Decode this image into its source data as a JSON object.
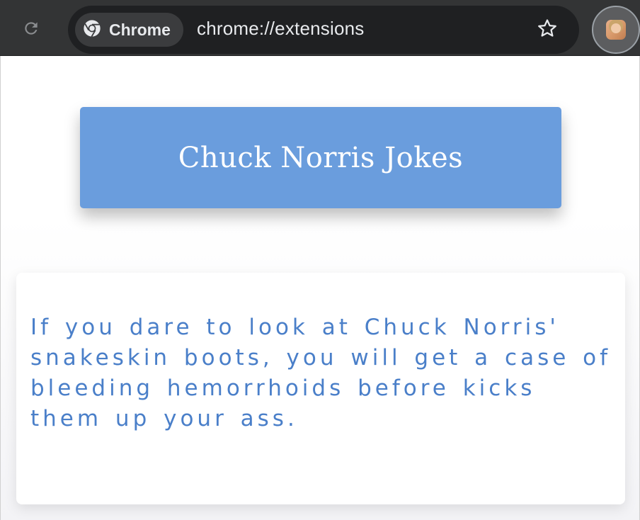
{
  "browser": {
    "chip_label": "Chrome",
    "url": "chrome://extensions",
    "icons": {
      "reload": "reload-icon",
      "chrome": "chrome-logo-icon",
      "bookmark": "star-icon",
      "extension": "extension-avatar-icon"
    }
  },
  "popup": {
    "title": "Chuck Norris Jokes",
    "joke": "If you dare to look at Chuck Norris' snakeskin boots, you will get a case of bleeding hemorrhoids before kicks them up your ass."
  },
  "colors": {
    "accent": "#6a9ddd",
    "joke_text": "#4a7fc9",
    "toolbar": "#333435"
  }
}
